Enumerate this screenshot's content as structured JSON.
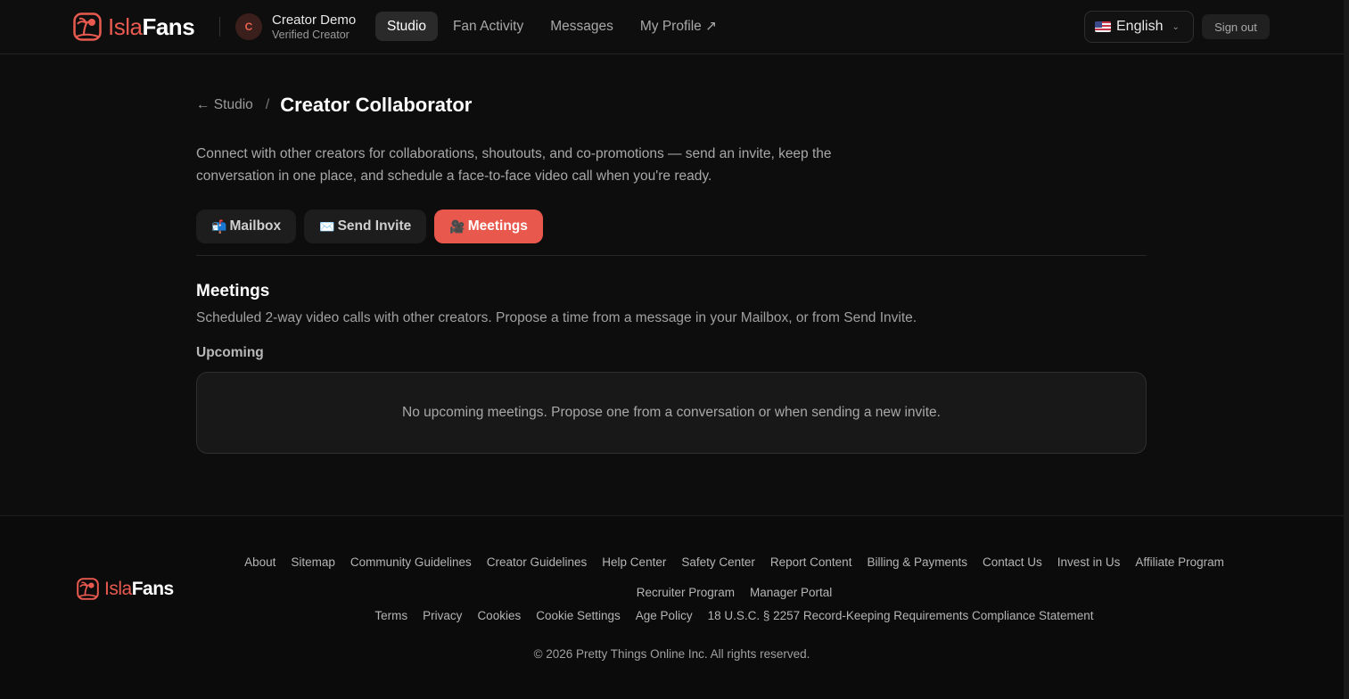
{
  "brand": {
    "part1": "Isla",
    "part2": "Fans",
    "accent": "#e85a4f"
  },
  "user": {
    "initial": "C",
    "name": "Creator Demo",
    "role": "Verified Creator"
  },
  "nav": {
    "items": [
      {
        "label": "Studio",
        "active": true
      },
      {
        "label": "Fan Activity"
      },
      {
        "label": "Messages"
      },
      {
        "label": "My Profile ↗"
      }
    ]
  },
  "language": {
    "selected": "English",
    "flag_icon": "us-flag-icon"
  },
  "signout_label": "Sign out",
  "breadcrumb": {
    "back": "← Studio",
    "separator": "/",
    "title": "Creator Collaborator"
  },
  "intro": "Connect with other creators for collaborations, shoutouts, and co-promotions — send an invite, keep the conversation in one place, and schedule a face-to-face video call when you're ready.",
  "tabs": [
    {
      "icon": "📬",
      "label": "Mailbox"
    },
    {
      "icon": "✉️",
      "label": "Send Invite"
    },
    {
      "icon": "🎥",
      "label": "Meetings",
      "active": true
    }
  ],
  "meetings": {
    "title": "Meetings",
    "description": "Scheduled 2-way video calls with other creators. Propose a time from a message in your Mailbox, or from Send Invite.",
    "upcoming_label": "Upcoming",
    "empty_text": "No upcoming meetings. Propose one from a conversation or when sending a new invite."
  },
  "footer": {
    "row1": [
      "About",
      "Sitemap",
      "Community Guidelines",
      "Creator Guidelines",
      "Help Center",
      "Safety Center",
      "Report Content",
      "Billing & Payments",
      "Contact Us",
      "Invest in Us",
      "Affiliate Program"
    ],
    "row2": [
      "Recruiter Program",
      "Manager Portal"
    ],
    "row3": [
      "Terms",
      "Privacy",
      "Cookies",
      "Cookie Settings",
      "Age Policy",
      "18 U.S.C. § 2257 Record-Keeping Requirements Compliance Statement"
    ],
    "copyright": "© 2026 Pretty Things Online Inc. All rights reserved."
  }
}
